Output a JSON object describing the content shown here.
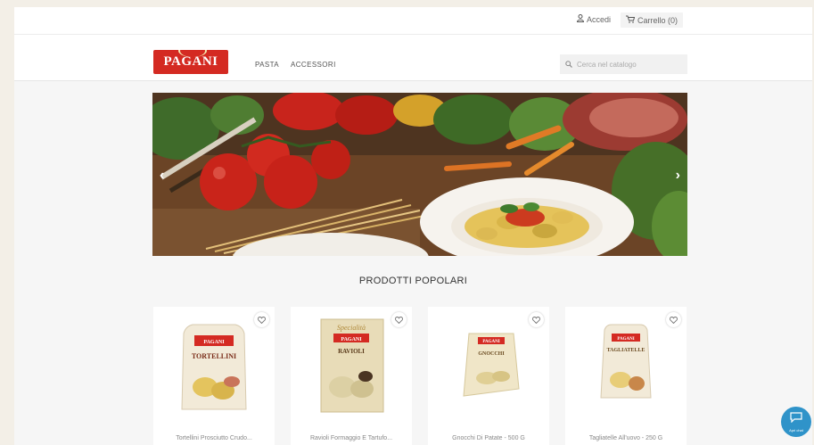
{
  "topbar": {
    "login_label": "Accedi",
    "cart_label": "Carrello (0)"
  },
  "header": {
    "logo_text": "PAGANI",
    "nav": [
      "PASTA",
      "ACCESSORI"
    ],
    "search_placeholder": "Cerca nel catalogo"
  },
  "hero": {
    "prev_icon": "chevron-left-icon",
    "next_icon": "chevron-right-icon"
  },
  "popular": {
    "title": "PRODOTTI POPOLARI",
    "products": [
      {
        "name": "Tortellini Prosciutto Crudo...",
        "package_brand": "PAGANI",
        "package_label": "TORTELLINI",
        "package_color": "#f2ead8"
      },
      {
        "name": "Ravioli Formaggio E Tartufo...",
        "package_brand": "PAGANI",
        "package_label": "RAVIOLI",
        "package_color": "#e8dcb8"
      },
      {
        "name": "Gnocchi Di Patate - 500 G",
        "package_brand": "PAGANI",
        "package_label": "GNOCCHI",
        "package_color": "#f0e6c8"
      },
      {
        "name": "Tagliatelle All'uovo - 250 G",
        "package_brand": "PAGANI",
        "package_label": "TAGLIATELLE",
        "package_color": "#f2ead8"
      }
    ]
  },
  "chat": {
    "label": "Apri chat"
  },
  "colors": {
    "brand_red": "#d42a22",
    "chat_blue": "#2f93c9"
  }
}
